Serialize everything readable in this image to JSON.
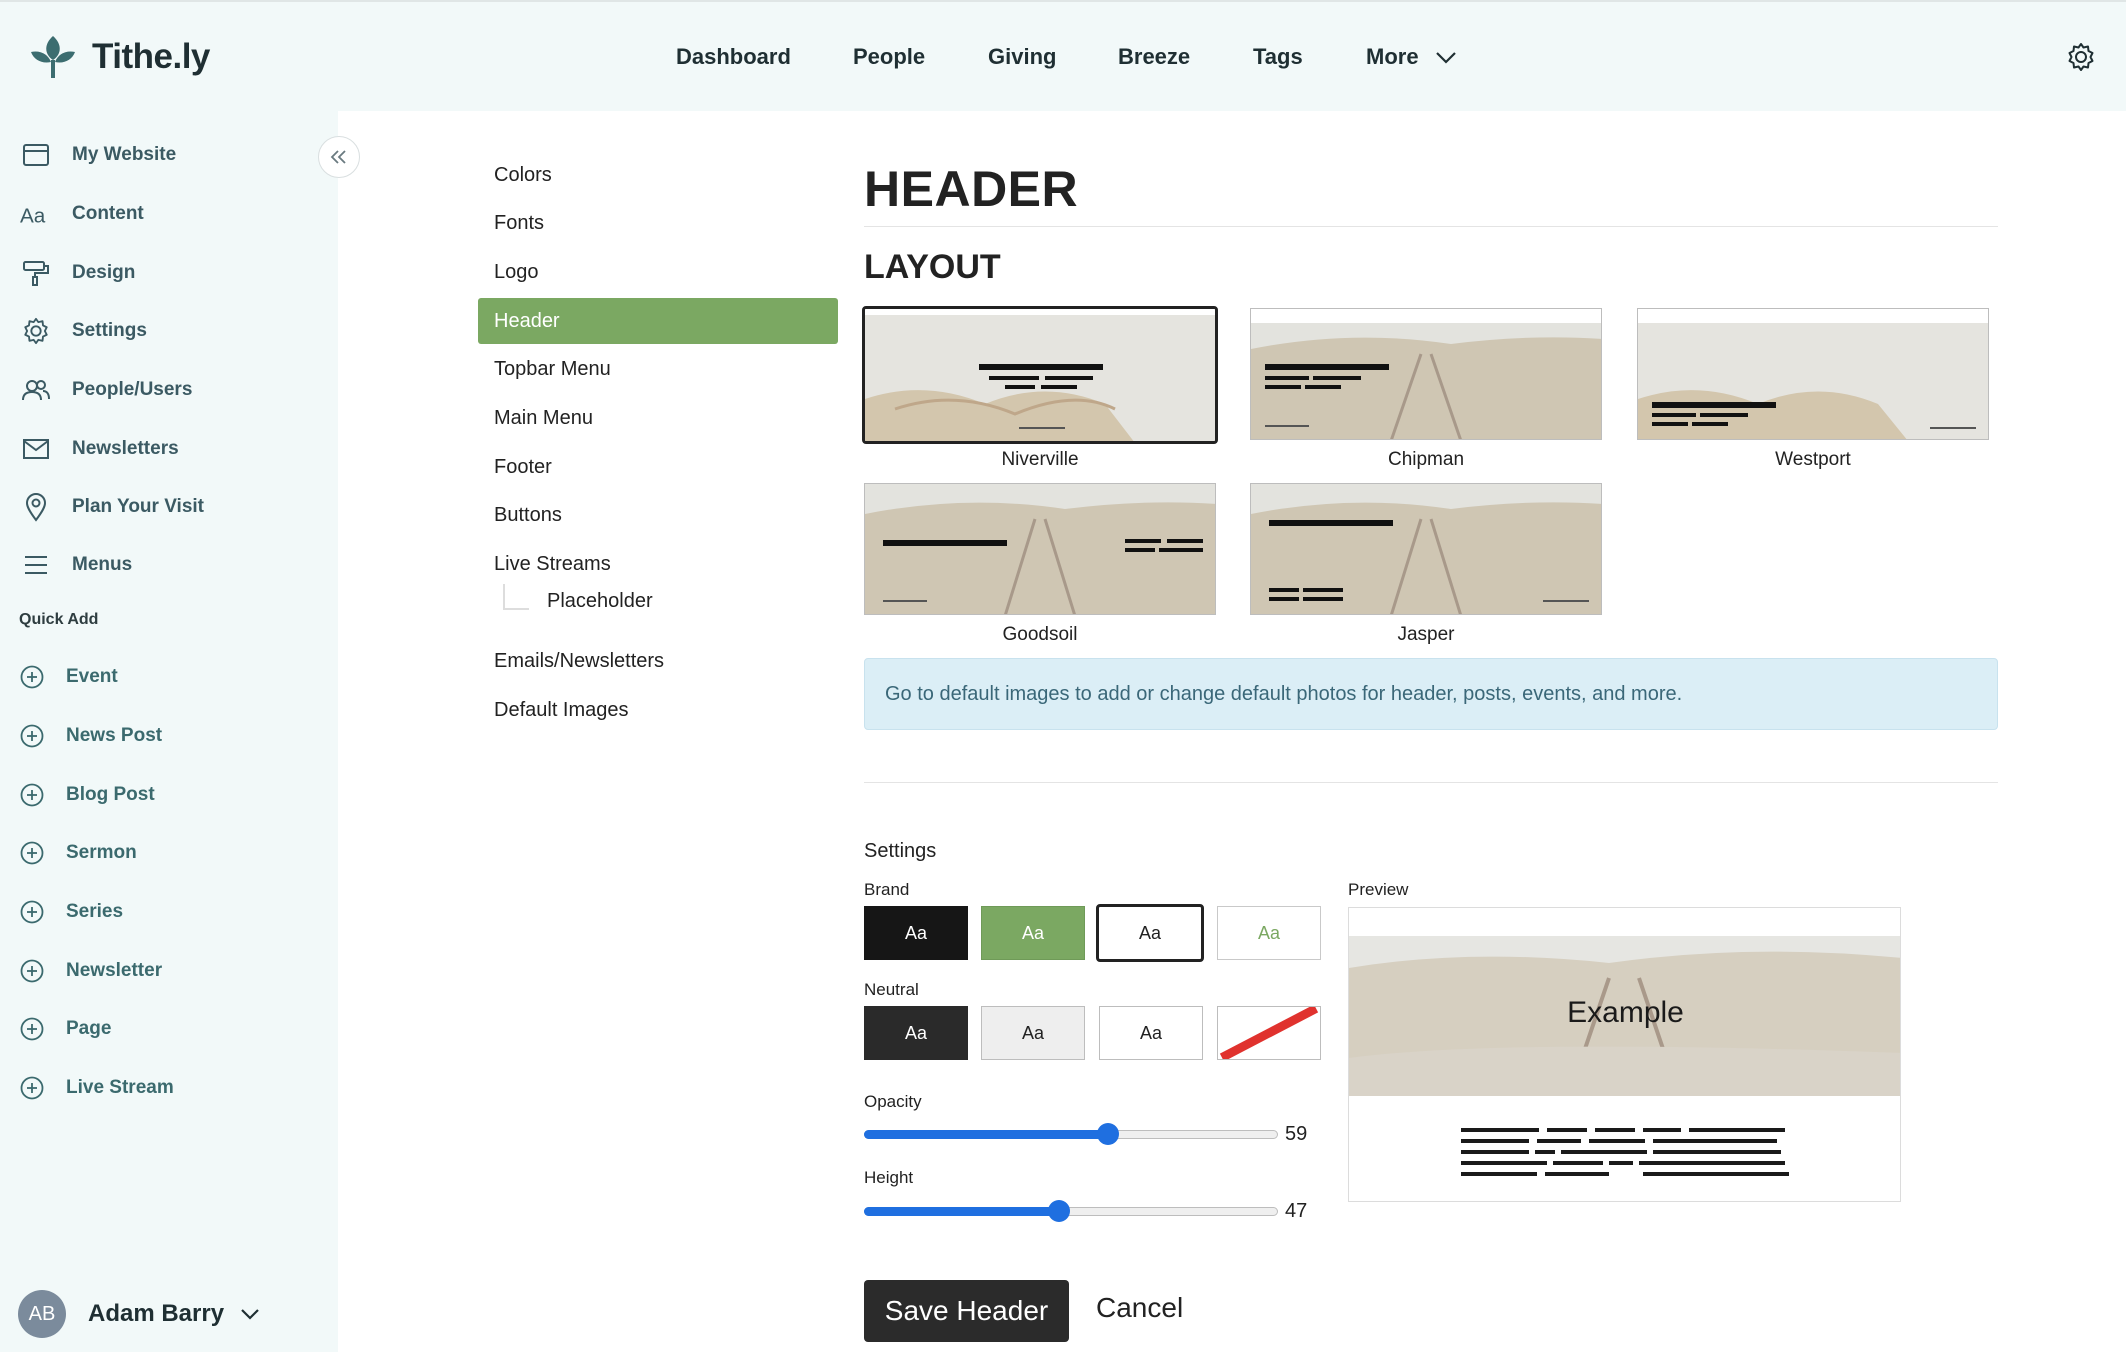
{
  "brand": {
    "name": "Tithe.ly",
    "accent": "#7ba862",
    "leaf_color": "#3c6d70"
  },
  "top_nav": {
    "items": [
      "Dashboard",
      "People",
      "Giving",
      "Breeze",
      "Tags",
      "More"
    ],
    "settings_icon": "gear-icon"
  },
  "sidebar": {
    "items": [
      {
        "label": "My Website",
        "icon": "browser-window-icon"
      },
      {
        "label": "Content",
        "icon": "text-aa-icon"
      },
      {
        "label": "Design",
        "icon": "paint-roller-icon"
      },
      {
        "label": "Settings",
        "icon": "gear-icon"
      },
      {
        "label": "People/Users",
        "icon": "users-icon"
      },
      {
        "label": "Newsletters",
        "icon": "envelope-icon"
      },
      {
        "label": "Plan Your Visit",
        "icon": "map-pin-icon"
      },
      {
        "label": "Menus",
        "icon": "hamburger-icon"
      }
    ],
    "quick_add_title": "Quick Add",
    "quick_add": [
      "Event",
      "News Post",
      "Blog Post",
      "Sermon",
      "Series",
      "Newsletter",
      "Page",
      "Live Stream"
    ],
    "user": {
      "initials": "AB",
      "name": "Adam Barry"
    }
  },
  "subnav": {
    "items": [
      "Colors",
      "Fonts",
      "Logo",
      "Header",
      "Topbar Menu",
      "Main Menu",
      "Footer",
      "Buttons",
      "Live Streams"
    ],
    "child": "Placeholder",
    "after": [
      "Emails/Newsletters",
      "Default Images"
    ],
    "active": "Header"
  },
  "main": {
    "title": "HEADER",
    "layout_title": "LAYOUT",
    "layouts": [
      "Niverville",
      "Chipman",
      "Westport",
      "Goodsoil",
      "Jasper"
    ],
    "selected_layout": "Niverville",
    "info": "Go to default images to add or change default photos for header, posts, events, and more.",
    "settings_title": "Settings",
    "brand_label": "Brand",
    "neutral_label": "Neutral",
    "swatch_text": "Aa",
    "preview_label": "Preview",
    "preview_text": "Example",
    "opacity_label": "Opacity",
    "opacity_value": 59,
    "height_label": "Height",
    "height_value": 47,
    "save_label": "Save Header",
    "cancel_label": "Cancel"
  }
}
